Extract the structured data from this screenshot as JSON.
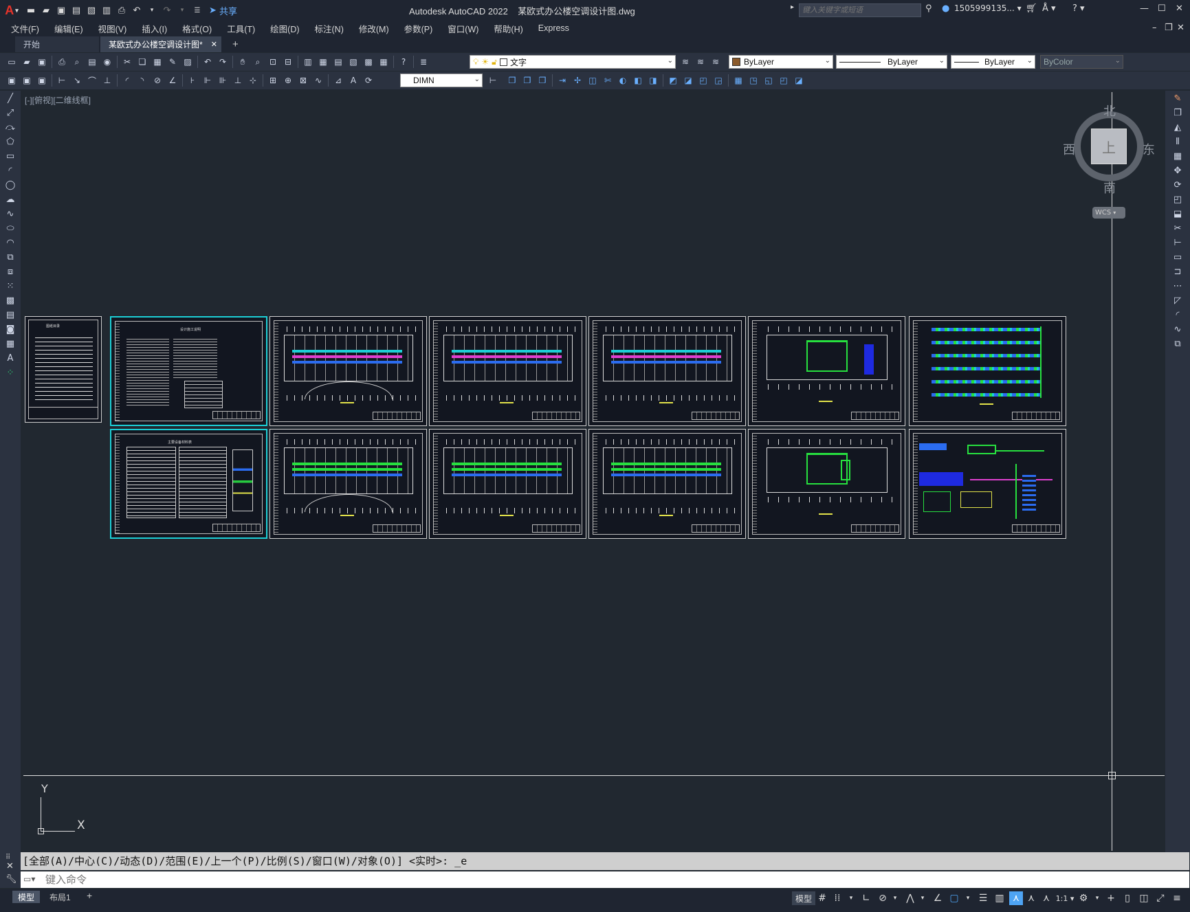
{
  "titlebar": {
    "app_name": "Autodesk AutoCAD 2022",
    "file_name": "某欧式办公楼空调设计图.dwg",
    "share_label": "共享",
    "search_placeholder": "键入关键字或短语",
    "user": "1505999135...",
    "logo_letter": "A"
  },
  "menu": [
    "文件(F)",
    "编辑(E)",
    "视图(V)",
    "插入(I)",
    "格式(O)",
    "工具(T)",
    "绘图(D)",
    "标注(N)",
    "修改(M)",
    "参数(P)",
    "窗口(W)",
    "帮助(H)",
    "Express"
  ],
  "tabs": [
    {
      "label": "开始"
    },
    {
      "label": "某欧式办公楼空调设计图*"
    }
  ],
  "properties": {
    "layer": "文字",
    "color": "ByLayer",
    "linetype": "ByLayer",
    "lineweight": "ByLayer",
    "plotstyle": "ByColor",
    "dimstyle": "DIMN"
  },
  "viewport_label": "[-][俯视][二维线框]",
  "viewcube": {
    "north": "北",
    "south": "南",
    "west": "西",
    "east": "东",
    "top": "上",
    "wcs": "WCS"
  },
  "ucs": {
    "x": "X",
    "y": "Y"
  },
  "command": {
    "history": "[全部(A)/中心(C)/动态(D)/范围(E)/上一个(P)/比例(S)/窗口(W)/对象(O)] <实时>: _e",
    "placeholder": "键入命令"
  },
  "layout_tabs": [
    "模型",
    "布局1"
  ],
  "status": {
    "model": "模型",
    "scale": "1:1"
  },
  "sheets": [
    {
      "title": "图纸目录"
    },
    {
      "title": "设计施工说明"
    },
    {
      "title": "主要设备材料表"
    }
  ]
}
